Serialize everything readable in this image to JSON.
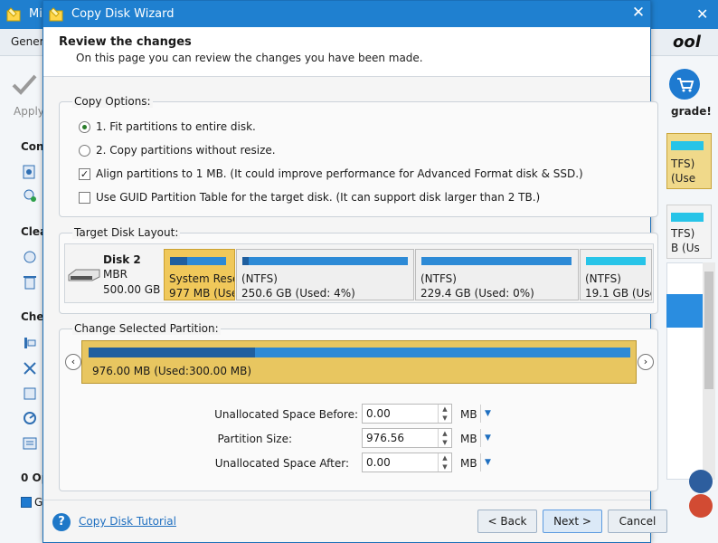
{
  "background_app": {
    "title": "Mi",
    "menu_general": "Gener",
    "logo_text": "ool",
    "apply_label": "Apply",
    "section_headers": [
      "Con",
      "Clea",
      "Che",
      "0 Op"
    ],
    "upgrade_label": "grade!",
    "disk1_lines": [
      "TFS)",
      "(Use"
    ],
    "disk2_lines": [
      "TFS)",
      "B (Us"
    ],
    "bottom_item": "G"
  },
  "dialog": {
    "title": "Copy Disk Wizard",
    "close_symbol": "✕",
    "header": {
      "title": "Review the changes",
      "subtitle": "On this page you can review the changes you have been made."
    },
    "copy_options": {
      "label": "Copy Options:",
      "options": [
        {
          "type": "radio",
          "checked": true,
          "label": "1. Fit partitions to entire disk."
        },
        {
          "type": "radio",
          "checked": false,
          "label": "2. Copy partitions without resize."
        },
        {
          "type": "checkbox",
          "checked": true,
          "label": "Align partitions to 1 MB.  (It could improve performance for Advanced Format disk & SSD.)"
        },
        {
          "type": "checkbox",
          "checked": false,
          "label": "Use GUID Partition Table for the target disk. (It can support disk larger than 2 TB.)"
        }
      ]
    },
    "target_layout": {
      "label": "Target Disk Layout:",
      "disk": {
        "name": "Disk 2",
        "type": "MBR",
        "size": "500.00 GB"
      },
      "partitions": [
        {
          "name": "System Rese",
          "size": "977 MB (Use",
          "used_fraction": 0.31,
          "selected": true,
          "bar_color": "#2d8ad6"
        },
        {
          "name": "(NTFS)",
          "size": "250.6 GB (Used: 4%)",
          "used_fraction": 0.04,
          "selected": false,
          "bar_color": "#2d8ad6"
        },
        {
          "name": "(NTFS)",
          "size": "229.4 GB (Used: 0%)",
          "used_fraction": 0.0,
          "selected": false,
          "bar_color": "#2d8ad6"
        },
        {
          "name": "(NTFS)",
          "size": "19.1 GB (Use",
          "used_fraction": 0.0,
          "selected": false,
          "bar_color": "#27c4e8"
        }
      ]
    },
    "change_partition": {
      "label": "Change Selected Partition:",
      "partition_text": "976.00 MB (Used:300.00 MB)",
      "used_fraction": 0.307,
      "prev_symbol": "‹",
      "next_symbol": "›",
      "fields": [
        {
          "label": "Unallocated Space Before:",
          "value": "0.00",
          "unit": "MB"
        },
        {
          "label": "Partition Size:",
          "value": "976.56",
          "unit": "MB"
        },
        {
          "label": "Unallocated Space After:",
          "value": "0.00",
          "unit": "MB"
        }
      ]
    },
    "footer": {
      "help_symbol": "?",
      "tutorial_link": "Copy Disk Tutorial",
      "back_label": "< Back",
      "next_label": "Next >",
      "cancel_label": "Cancel"
    }
  }
}
